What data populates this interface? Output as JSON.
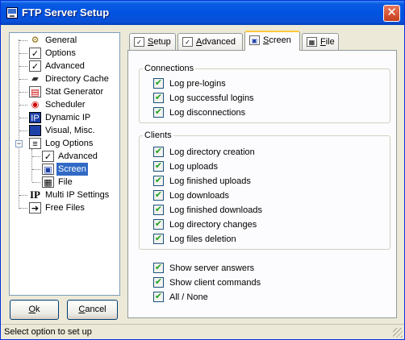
{
  "window": {
    "title": "FTP Server Setup",
    "close_label": "✕"
  },
  "tree": {
    "items": [
      {
        "label": "General",
        "icon": "gear-icon"
      },
      {
        "label": "Options",
        "icon": "checklist-icon"
      },
      {
        "label": "Advanced",
        "icon": "checklist-icon"
      },
      {
        "label": "Directory Cache",
        "icon": "memory-icon"
      },
      {
        "label": "Stat Generator",
        "icon": "stats-icon"
      },
      {
        "label": "Scheduler",
        "icon": "scheduler-icon"
      },
      {
        "label": "Dynamic IP",
        "icon": "ip-icon"
      },
      {
        "label": "Visual, Misc.",
        "icon": "monitor-icon"
      },
      {
        "label": "Log Options",
        "icon": "log-icon",
        "expander": "−"
      },
      {
        "label": "Advanced",
        "icon": "checklist-icon"
      },
      {
        "label": "Screen",
        "icon": "screen-icon",
        "selected": true
      },
      {
        "label": "File",
        "icon": "file-icon"
      },
      {
        "label": "Multi IP Settings",
        "icon": "ip-icon"
      },
      {
        "label": "Free Files",
        "icon": "free-files-icon"
      }
    ]
  },
  "buttons": {
    "ok_u": "O",
    "ok_rest": "k",
    "cancel_u": "C",
    "cancel_rest": "ancel"
  },
  "tabs": [
    {
      "label": "Setup",
      "u": "S",
      "rest": "etup"
    },
    {
      "label": "Advanced",
      "u": "A",
      "rest": "dvanced"
    },
    {
      "label": "Screen",
      "u": "S",
      "rest": "creen",
      "active": true
    },
    {
      "label": "File",
      "u": "F",
      "rest": "ile"
    }
  ],
  "connections": {
    "legend": "Connections",
    "options": [
      {
        "label": "Log pre-logins",
        "checked": true
      },
      {
        "label": "Log successful logins",
        "checked": true
      },
      {
        "label": "Log disconnections",
        "checked": true
      }
    ]
  },
  "clients": {
    "legend": "Clients",
    "options": [
      {
        "label": "Log directory creation",
        "checked": true
      },
      {
        "label": "Log uploads",
        "checked": true
      },
      {
        "label": "Log finished uploads",
        "checked": true
      },
      {
        "label": "Log downloads",
        "checked": true
      },
      {
        "label": "Log finished downloads",
        "checked": true
      },
      {
        "label": "Log directory changes",
        "checked": true
      },
      {
        "label": "Log files deletion",
        "checked": true
      }
    ]
  },
  "extra": {
    "options": [
      {
        "label": "Show server answers",
        "checked": true
      },
      {
        "label": "Show client commands",
        "checked": true
      },
      {
        "label": "All / None",
        "checked": true
      }
    ]
  },
  "check_glyph": "✔",
  "status": {
    "text": "Select option to set up"
  }
}
